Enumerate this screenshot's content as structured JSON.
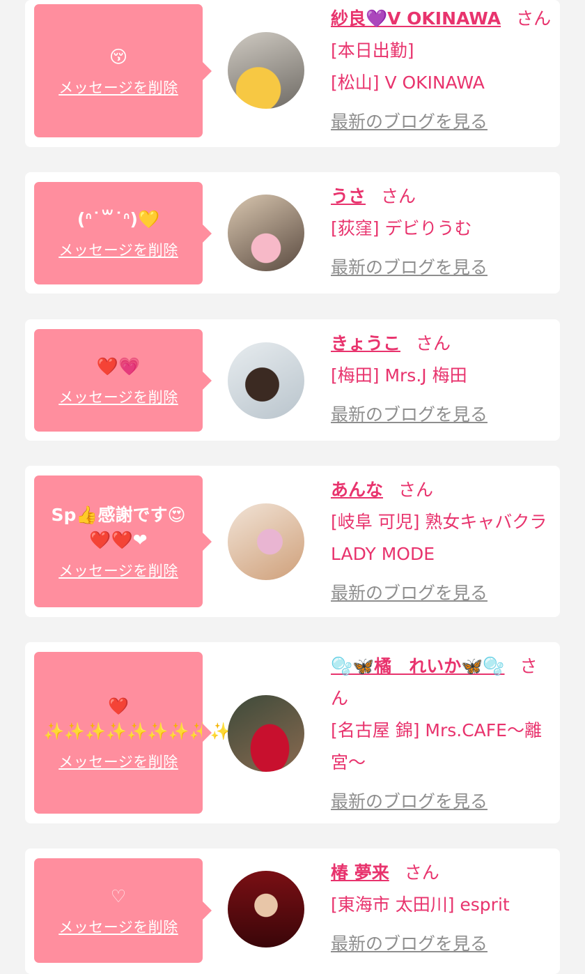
{
  "delete_label": "メッセージを削除",
  "san_label": "さん",
  "blog_label": "最新のブログを見る",
  "colors": {
    "bubble": "#ff8e9e",
    "name": "#e8336d",
    "link_gray": "#8e8e8e",
    "background": "#f3f3f3"
  },
  "entries": [
    {
      "message": "😚",
      "name": "紗良💜V OKINAWA",
      "shop": "[松山] V OKINAWA",
      "status": "[本日出勤]"
    },
    {
      "message": "(ᐢ˙꒳˙ᐢ)💛",
      "name": "うさ",
      "shop": "[荻窪] デビりうむ"
    },
    {
      "message": "❤️💗",
      "name": "きょうこ",
      "shop": "[梅田] Mrs.J 梅田"
    },
    {
      "message": "Sp👍感謝です😍❤️❤️❤",
      "name": "あんな",
      "shop": "[岐阜 可児] 熟女キャバクラ LADY MODE"
    },
    {
      "message": "❤️ ✨✨✨✨✨✨✨✨✨✨",
      "name": "🫧🦋橘　れいか🦋🫧",
      "shop": "[名古屋 錦] Mrs.CAFE〜離宮〜"
    },
    {
      "message": "♡",
      "name": "椿 夢来",
      "shop": "[東海市 太田川] esprit"
    }
  ]
}
